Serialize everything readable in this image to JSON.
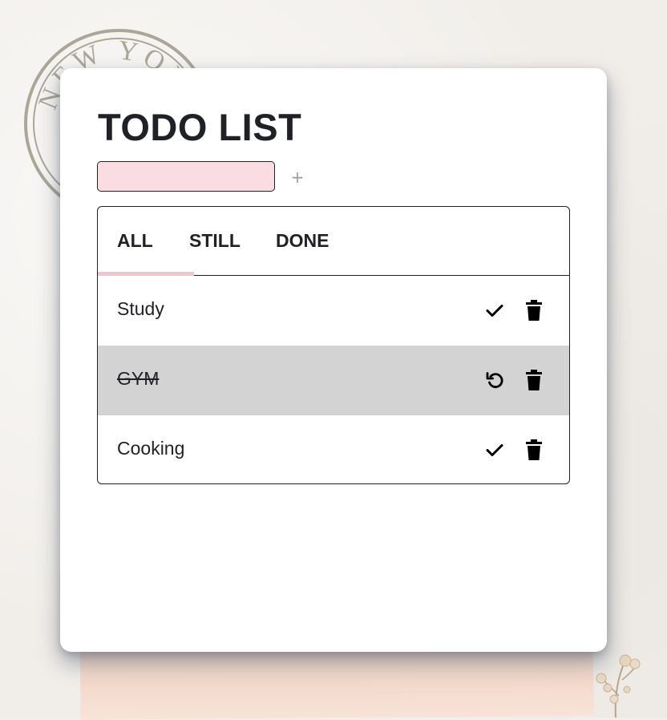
{
  "app": {
    "title": "TODO LIST"
  },
  "input": {
    "value": "",
    "placeholder": "",
    "add_symbol": "+"
  },
  "tabs": [
    {
      "label": "ALL",
      "active": true
    },
    {
      "label": "STILL",
      "active": false
    },
    {
      "label": "DONE",
      "active": false
    }
  ],
  "tasks": [
    {
      "label": "Study",
      "done": false,
      "toggle_icon": "check-icon",
      "delete_icon": "trash-icon"
    },
    {
      "label": "GYM",
      "done": true,
      "toggle_icon": "undo-icon",
      "delete_icon": "trash-icon"
    },
    {
      "label": "Cooking",
      "done": false,
      "toggle_icon": "check-icon",
      "delete_icon": "trash-icon"
    }
  ],
  "background": {
    "stamp_text": "NEW YORK"
  },
  "colors": {
    "accent": "#f2c4cc",
    "input_bg": "#f9dde3",
    "done_row_bg": "#d3d3d3",
    "text": "#1f2126"
  }
}
